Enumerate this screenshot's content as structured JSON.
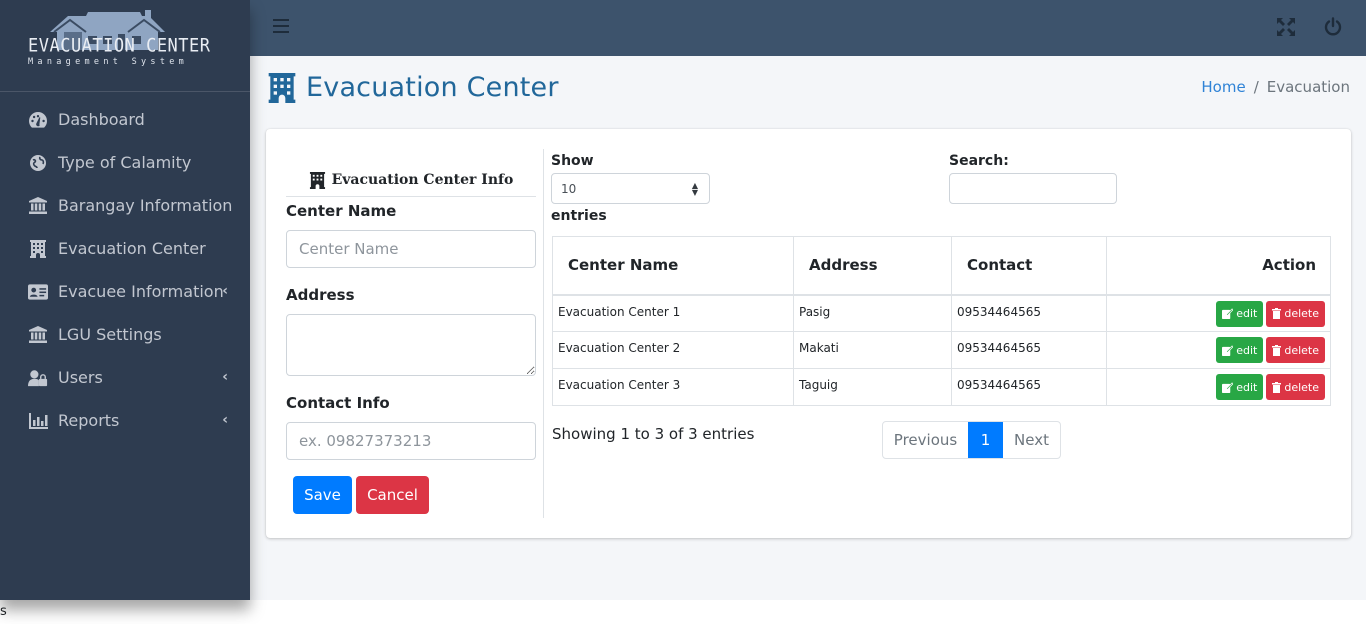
{
  "brand": {
    "title": "EVACUATION CENTER",
    "subtitle": "Management System"
  },
  "sidebar": {
    "items": [
      {
        "label": "Dashboard",
        "icon": "tachometer-icon",
        "has_submenu": false
      },
      {
        "label": "Type of Calamity",
        "icon": "globe-icon",
        "has_submenu": false
      },
      {
        "label": "Barangay Information",
        "icon": "landmark-icon",
        "has_submenu": false
      },
      {
        "label": "Evacuation Center",
        "icon": "building-icon",
        "has_submenu": false
      },
      {
        "label": "Evacuee Information",
        "icon": "id-card-icon",
        "has_submenu": true
      },
      {
        "label": "LGU Settings",
        "icon": "university-icon",
        "has_submenu": false
      },
      {
        "label": "Users",
        "icon": "user-lock-icon",
        "has_submenu": true
      },
      {
        "label": "Reports",
        "icon": "chart-bar-icon",
        "has_submenu": true
      }
    ],
    "chevron": "‹"
  },
  "header": {
    "page_title": "Evacuation Center",
    "breadcrumb": {
      "home": "Home",
      "separator": "/",
      "current": "Evacuation"
    }
  },
  "form": {
    "heading": "Evacuation Center Info",
    "center_name_label": "Center Name",
    "center_name_placeholder": "Center Name",
    "center_name_value": "",
    "address_label": "Address",
    "address_value": "",
    "contact_label": "Contact Info",
    "contact_placeholder": "ex. 09827373213",
    "contact_value": "",
    "save_label": "Save",
    "cancel_label": "Cancel"
  },
  "table": {
    "show_label": "Show",
    "page_size": "10",
    "entries_label": "entries",
    "search_label": "Search:",
    "search_value": "",
    "columns": [
      "Center Name",
      "Address",
      "Contact",
      "Action"
    ],
    "rows": [
      {
        "name": "Evacuation Center 1",
        "address": "Pasig",
        "contact": "09534464565"
      },
      {
        "name": "Evacuation Center 2",
        "address": "Makati",
        "contact": "09534464565"
      },
      {
        "name": "Evacuation Center 3",
        "address": "Taguig",
        "contact": "09534464565"
      }
    ],
    "edit_label": "edit",
    "delete_label": "delete",
    "info": "Showing 1 to 3 of 3 entries",
    "pagination": {
      "previous": "Previous",
      "current": "1",
      "next": "Next"
    }
  },
  "colors": {
    "sidebar_bg": "#2e3c50",
    "topbar_bg": "#3d536c",
    "title": "#21679a",
    "primary": "#007bff",
    "danger": "#dc3545",
    "success": "#28a745"
  },
  "stray_text": "s"
}
